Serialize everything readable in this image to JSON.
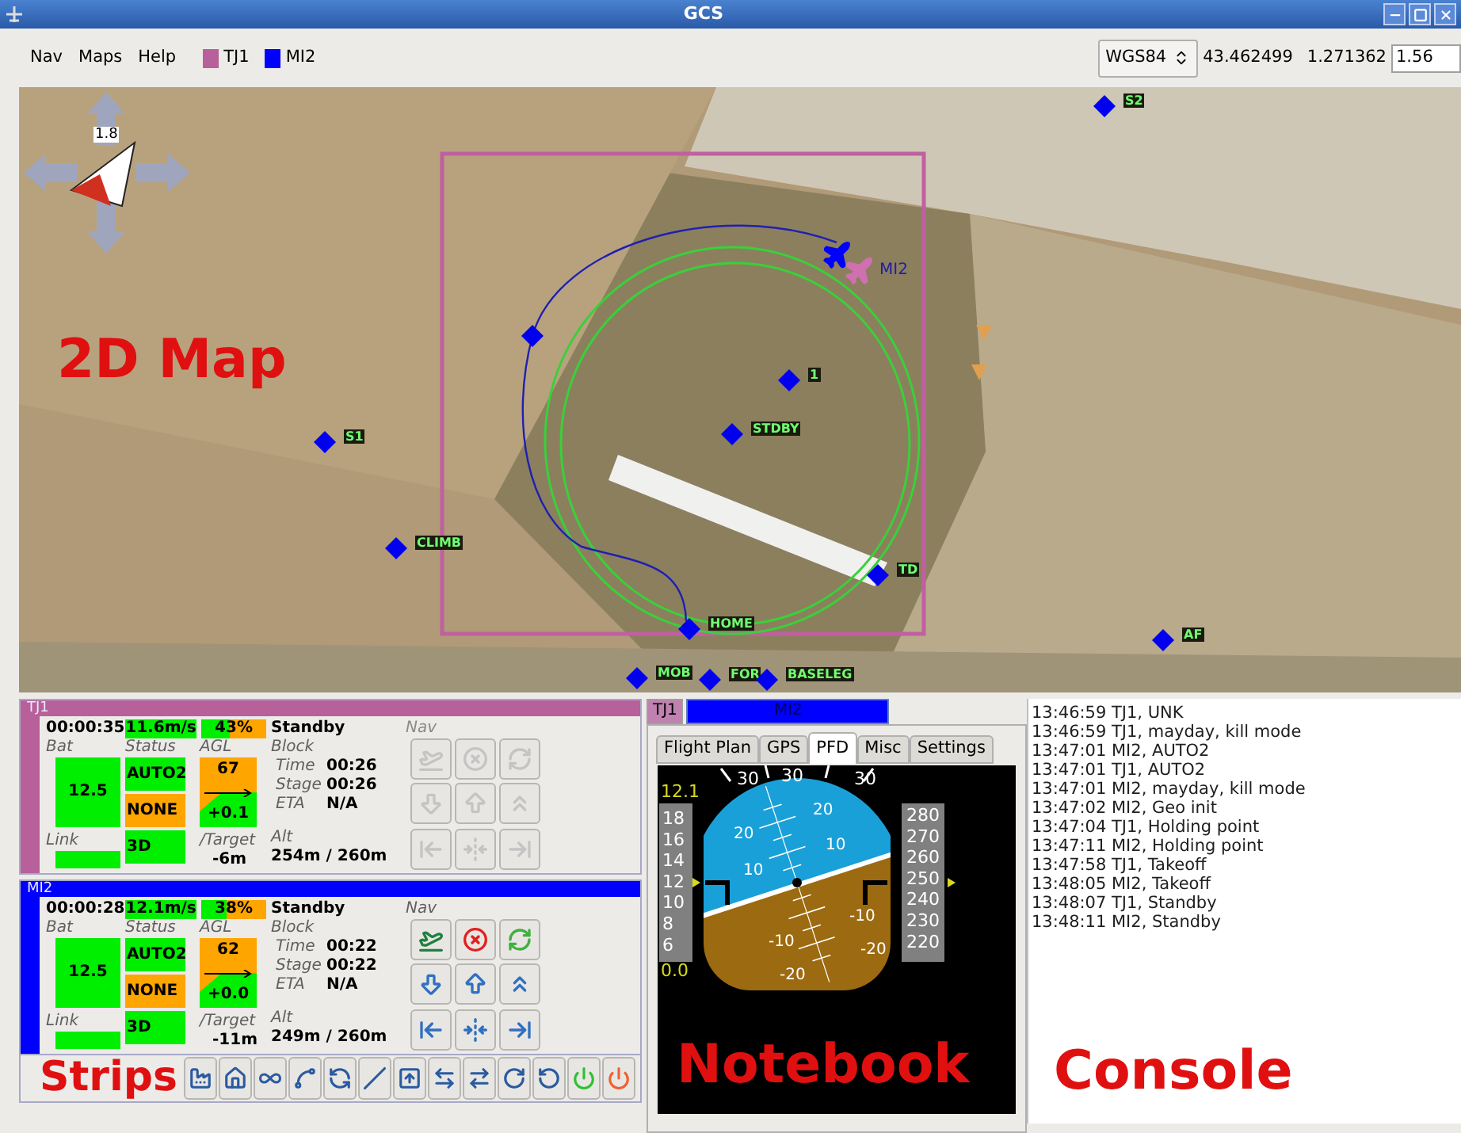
{
  "window": {
    "title": "GCS"
  },
  "menu": [
    {
      "label": "Nav"
    },
    {
      "label": "Maps"
    },
    {
      "label": "Help"
    }
  ],
  "aircraft_legend": [
    {
      "label": "TJ1",
      "color": "#b8609a"
    },
    {
      "label": "MI2",
      "color": "#0000ff"
    }
  ],
  "coordinates": {
    "datum": "WGS84",
    "lat": "43.462499",
    "lon": "1.271362",
    "zoom": "1.56"
  },
  "map": {
    "compass_zoom": "1.8",
    "annotation": "2D Map",
    "waypoints": [
      {
        "label": "S2"
      },
      {
        "label": "1"
      },
      {
        "label": "STDBY"
      },
      {
        "label": "S1"
      },
      {
        "label": "CLIMB"
      },
      {
        "label": "TD"
      },
      {
        "label": "HOME"
      },
      {
        "label": "MOB"
      },
      {
        "label": "FOR"
      },
      {
        "label": "BASELEG"
      },
      {
        "label": "AF"
      }
    ],
    "aircraft": [
      {
        "label": "MI2",
        "color": "#0000ff"
      },
      {
        "color": "#d070b0"
      }
    ]
  },
  "strips": [
    {
      "name": "TJ1",
      "color": "#b8609a",
      "flight_time": "00:00:35",
      "speed": "11.6m/s",
      "throttle": "43%",
      "level": 0.43,
      "mode": "Standby",
      "labels": {
        "bat": "Bat",
        "status": "Status",
        "agl": "AGL",
        "block": "Block",
        "time": "Time",
        "stage": "Stage",
        "eta": "ETA",
        "link": "Link",
        "target": "/Target",
        "alt": "Alt",
        "nav": "Nav"
      },
      "bat": "12.5",
      "status": [
        {
          "text": "AUTO2",
          "color": "#00ee00"
        },
        {
          "text": "NONE",
          "color": "#ffa500"
        },
        {
          "text": "3D",
          "color": "#00ee00"
        }
      ],
      "agl": "67",
      "climb": "+0.1",
      "target": "-6m",
      "block_time": "00:26",
      "stage_time": "00:26",
      "eta": "N/A",
      "alt": "254m / 260m",
      "nav_enabled": false
    },
    {
      "name": "MI2",
      "color": "#0000ff",
      "flight_time": "00:00:28",
      "speed": "12.1m/s",
      "throttle": "38%",
      "level": 0.38,
      "mode": "Standby",
      "labels": {
        "bat": "Bat",
        "status": "Status",
        "agl": "AGL",
        "block": "Block",
        "time": "Time",
        "stage": "Stage",
        "eta": "ETA",
        "link": "Link",
        "target": "/Target",
        "alt": "Alt",
        "nav": "Nav"
      },
      "bat": "12.5",
      "status": [
        {
          "text": "AUTO2",
          "color": "#00ee00"
        },
        {
          "text": "NONE",
          "color": "#ffa500"
        },
        {
          "text": "3D",
          "color": "#00ee00"
        }
      ],
      "agl": "62",
      "climb": "+0.0",
      "target": "-11m",
      "block_time": "00:22",
      "stage_time": "00:22",
      "eta": "N/A",
      "alt": "249m / 260m",
      "nav_enabled": true
    }
  ],
  "strips_annotation": "Strips",
  "notebook": {
    "aircraft_tabs": [
      {
        "label": "TJ1",
        "color": "#c080b0",
        "selected": false
      },
      {
        "label": "MI2",
        "color": "#0000ff",
        "selected": true
      }
    ],
    "tabs": [
      {
        "label": "Flight Plan",
        "selected": false
      },
      {
        "label": "GPS",
        "selected": false
      },
      {
        "label": "PFD",
        "selected": true
      },
      {
        "label": "Misc",
        "selected": false
      },
      {
        "label": "Settings",
        "selected": false
      }
    ],
    "pfd": {
      "speed": "12.1",
      "speed_min": "0.0",
      "speed_ticks": [
        "18",
        "16",
        "14",
        "12",
        "10",
        "8",
        "6"
      ],
      "alt_ticks": [
        "280",
        "270",
        "260",
        "250",
        "240",
        "230",
        "220"
      ],
      "roll_labels": [
        "30",
        "30",
        "30"
      ],
      "pitch_labels": [
        "20",
        "10",
        "20",
        "10",
        "-10",
        "-20",
        "-10",
        "-20"
      ]
    },
    "annotation": "Notebook"
  },
  "console": {
    "annotation": "Console",
    "lines": [
      "13:46:59 TJ1, UNK",
      "13:46:59 TJ1, mayday, kill mode",
      "13:47:01 MI2, AUTO2",
      "13:47:01 TJ1, AUTO2",
      "13:47:01 MI2, mayday, kill mode",
      "13:47:02 MI2, Geo init",
      "13:47:04 TJ1, Holding point",
      "13:47:11 MI2, Holding point",
      "13:47:58 TJ1, Takeoff",
      "13:48:05 MI2, Takeoff",
      "13:48:07 TJ1, Standby",
      "13:48:11 MI2, Standby"
    ]
  }
}
